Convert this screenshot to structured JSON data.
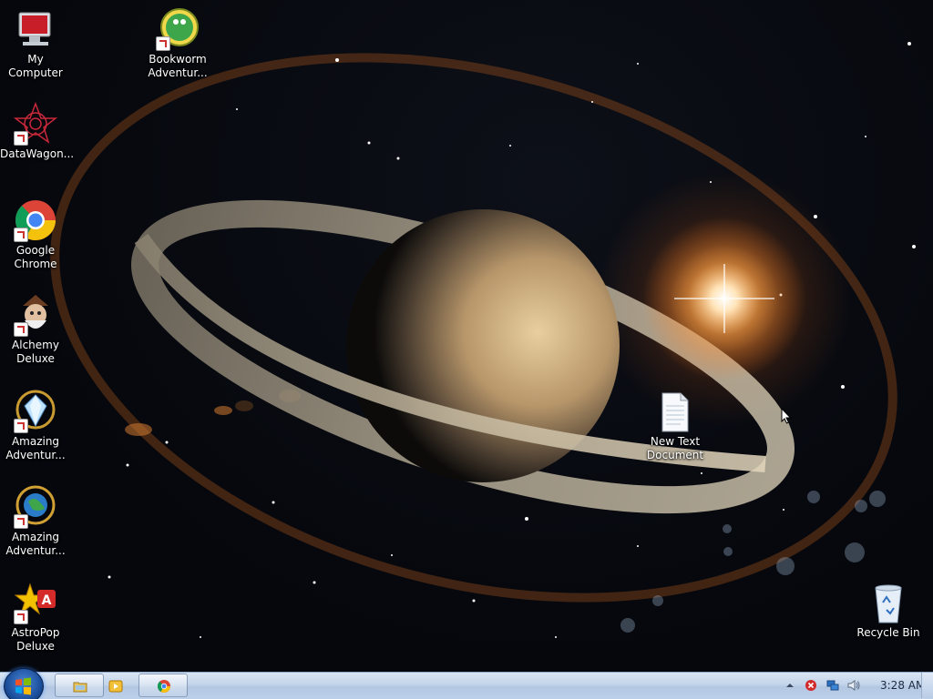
{
  "desktop_icons": [
    {
      "id": "my-computer",
      "label": "My Computer",
      "icon": "computer-icon"
    },
    {
      "id": "bookworm",
      "label": "Bookworm\nAdventur...",
      "icon": "bookworm-icon"
    },
    {
      "id": "datawagon",
      "label": "DataWagon...",
      "icon": "datawagon-icon"
    },
    {
      "id": "chrome",
      "label": "Google\nChrome",
      "icon": "chrome-icon"
    },
    {
      "id": "alchemy",
      "label": "Alchemy\nDeluxe",
      "icon": "alchemy-icon"
    },
    {
      "id": "amazing1",
      "label": "Amazing\nAdventur...",
      "icon": "diamond-icon"
    },
    {
      "id": "amazing2",
      "label": "Amazing\nAdventur...",
      "icon": "globe-icon"
    },
    {
      "id": "astropop",
      "label": "AstroPop\nDeluxe",
      "icon": "astropop-icon"
    },
    {
      "id": "newtext",
      "label": "New Text\nDocument",
      "icon": "text-document-icon"
    },
    {
      "id": "recycle",
      "label": "Recycle Bin",
      "icon": "recycle-bin-icon"
    }
  ],
  "taskbar": {
    "start_icon": "windows-start-icon",
    "pinned": [
      {
        "name": "explorer",
        "icon": "folder-icon"
      },
      {
        "name": "media-player",
        "icon": "media-player-icon"
      },
      {
        "name": "chrome",
        "icon": "chrome-icon"
      }
    ],
    "tray": {
      "icons": [
        "show-hidden-icons-icon",
        "security-alert-icon",
        "network-icon",
        "volume-icon"
      ],
      "time": "3:28 AM"
    }
  },
  "colors": {
    "taskbar_top": "#d9e5f3",
    "taskbar_bottom": "#bcd0ea",
    "sunflare": "#ffb050"
  }
}
